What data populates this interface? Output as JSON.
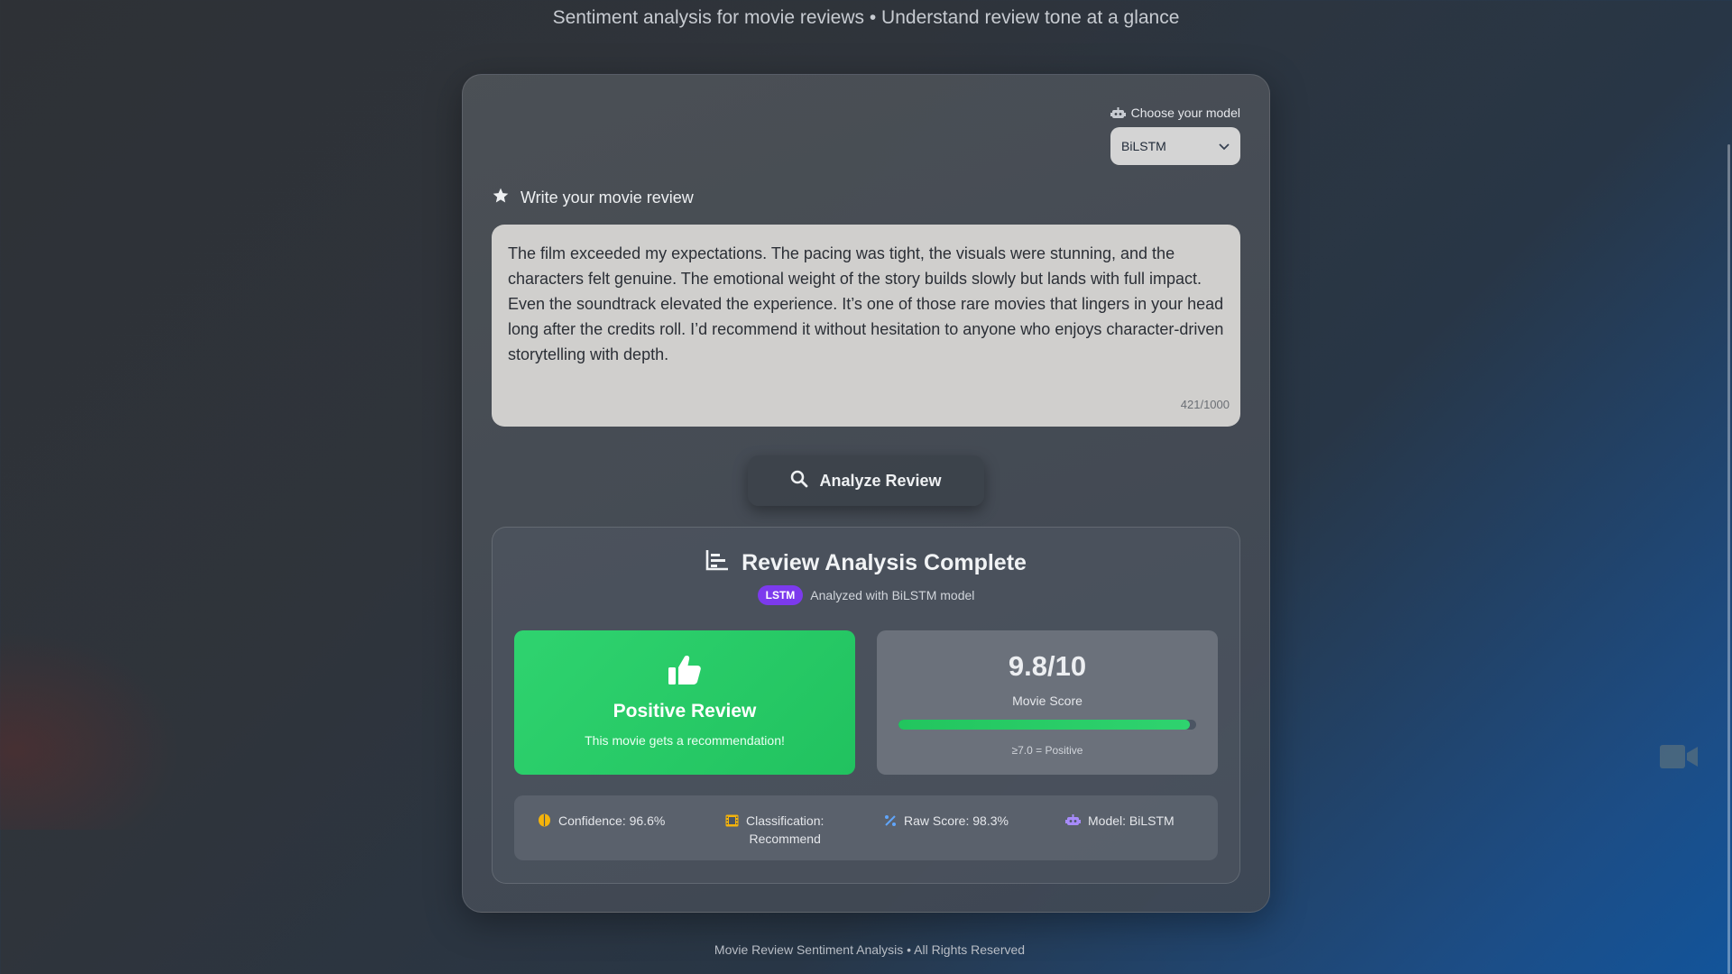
{
  "header": {
    "tagline": "Sentiment analysis for movie reviews • Understand review tone at a glance"
  },
  "model": {
    "label": "Choose your model",
    "selected": "BiLSTM"
  },
  "review": {
    "heading": "Write your movie review",
    "text": "The film exceeded my expectations. The pacing was tight, the visuals were stunning, and the characters felt genuine. The emotional weight of the story builds slowly but lands with full impact. Even the soundtrack elevated the experience. It’s one of those rare movies that lingers in your head long after the credits roll. I’d recommend it without hesitation to anyone who enjoys character-driven storytelling with depth.",
    "char_count": "421/1000"
  },
  "analyze_button": "Analyze Review",
  "results": {
    "title": "Review Analysis Complete",
    "badge": "LSTM",
    "subtitle": "Analyzed with BiLSTM model",
    "sentiment": {
      "title": "Positive Review",
      "subtitle": "This movie gets a recommendation!"
    },
    "score": {
      "value": "9.8/10",
      "label": "Movie Score",
      "fraction": 0.98,
      "threshold": "≥7.0 = Positive"
    },
    "stats": {
      "confidence": "Confidence: 96.6%",
      "classification_line1": "Classification:",
      "classification_line2": "Recommend",
      "raw_score": "Raw Score: 98.3%",
      "model": "Model: BiLSTM"
    }
  },
  "footer": "Movie Review Sentiment Analysis • All Rights Reserved",
  "colors": {
    "positive": "#22c55e",
    "badge": "#7c3aed",
    "stat_icon_confidence": "#f5b40b",
    "stat_icon_classification": "#f5b40b",
    "stat_icon_raw": "#60a5fa",
    "stat_icon_model": "#a78bfa"
  }
}
